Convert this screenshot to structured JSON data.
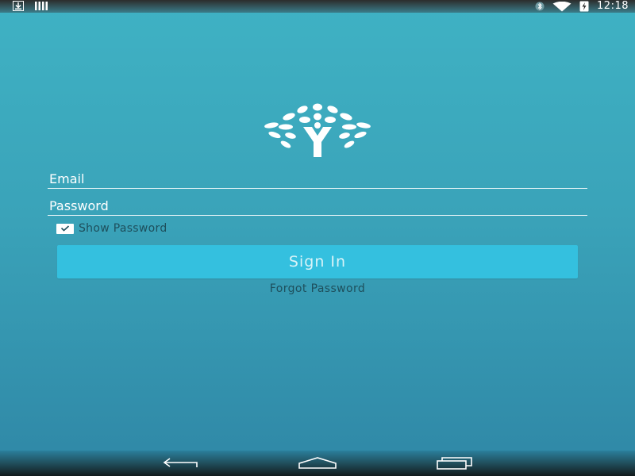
{
  "status_bar": {
    "left_icons": [
      "download-icon",
      "signal-bars-icon"
    ],
    "right_icons": [
      "bluetooth-icon",
      "wifi-icon",
      "battery-charging-icon"
    ],
    "time": "12:18"
  },
  "logo": {
    "icon": "tree-logo-icon"
  },
  "form": {
    "email_placeholder": "Email",
    "password_placeholder": "Password",
    "show_password_label": "Show Password",
    "show_password_checked": true,
    "sign_in_label": "Sign In",
    "forgot_password_label": "Forgot Password"
  },
  "nav_bar": {
    "buttons": [
      "back-icon",
      "home-icon",
      "recents-icon"
    ]
  },
  "colors": {
    "background_top": "#3fb2c4",
    "background_bottom": "#2f87a6",
    "button": "#34c0df",
    "button_text": "#d8f3f8",
    "secondary_text": "#1e4f5c"
  }
}
